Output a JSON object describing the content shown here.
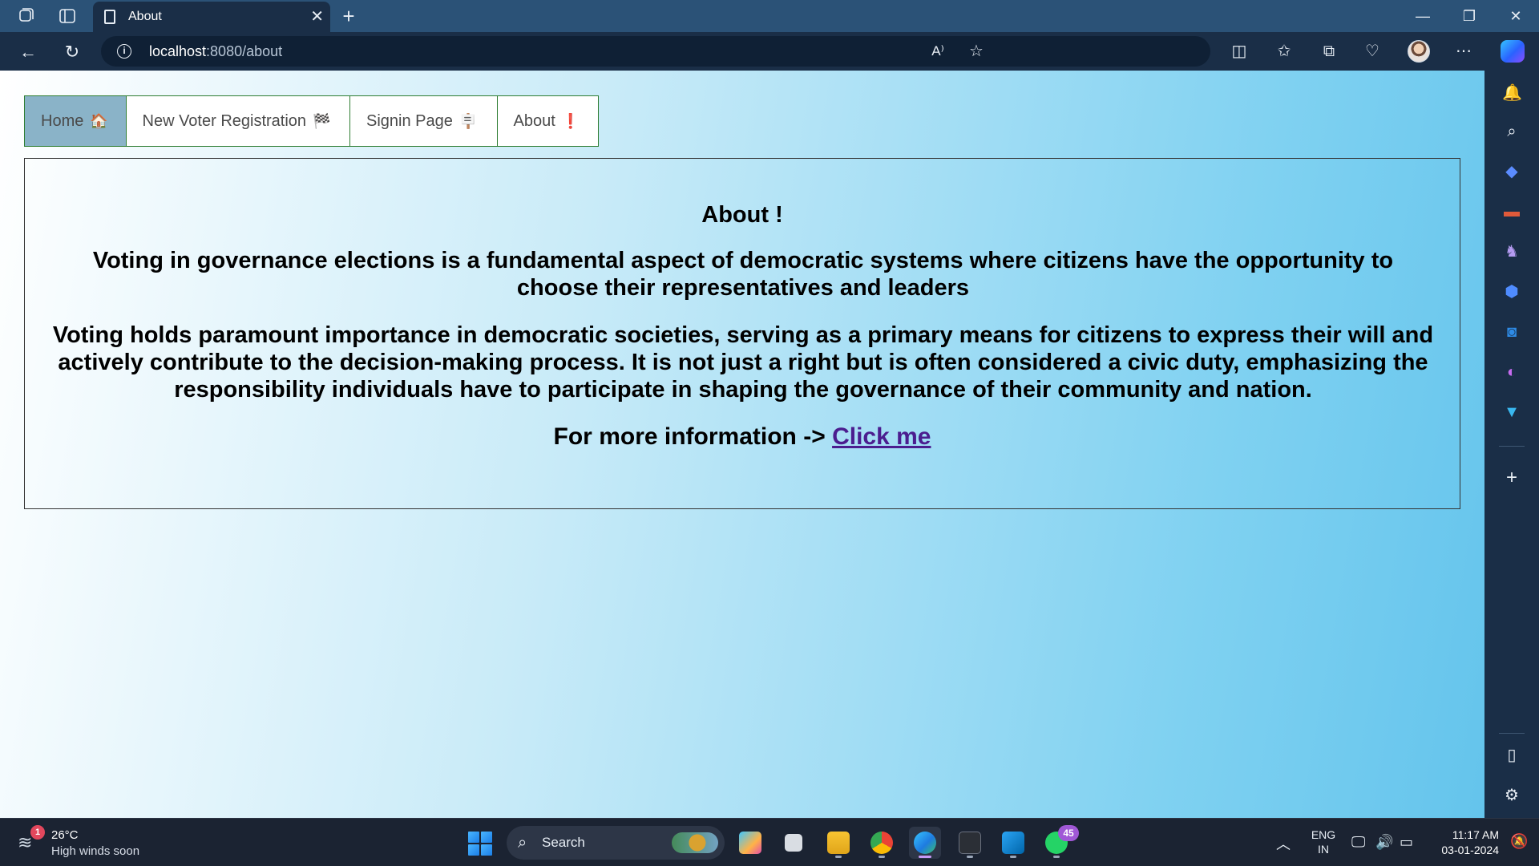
{
  "browser": {
    "tab_title": "About",
    "new_tab_glyph": "+",
    "url_host": "localhost",
    "url_path": ":8080/about",
    "icons": [
      "workspaces-icon",
      "tab-actions-icon",
      "back-icon",
      "refresh-icon",
      "read-aloud-icon",
      "favorite-star-icon",
      "split-screen-icon",
      "favorites-icon",
      "collections-icon",
      "browser-essentials-icon",
      "profile-avatar",
      "more-options-icon",
      "copilot-icon"
    ],
    "window_controls": [
      "minimize",
      "restore",
      "close"
    ]
  },
  "page": {
    "nav": {
      "home": "Home",
      "home_emoji": "🏠",
      "register": "New Voter Registration",
      "register_emoji": "🏁",
      "signin": "Signin Page",
      "signin_emoji": "🪧",
      "about": "About",
      "about_emoji": "❗"
    },
    "about": {
      "title": "About !",
      "paragraph1": "Voting in governance elections is a fundamental aspect of democratic systems where citizens have the opportunity to choose their representatives and leaders",
      "paragraph2": "Voting holds paramount importance in democratic societies, serving as a primary means for citizens to express their will and actively contribute to the decision-making process. It is not just a right but is often considered a civic duty, emphasizing the responsibility individuals have to participate in shaping the governance of their community and nation.",
      "more_prefix": "For more information -> ",
      "more_link": "Click me"
    },
    "colors": {
      "nav_border": "#2e7d32",
      "nav_active_bg": "#8ab3c8",
      "link": "#4b1d8f",
      "bg_gradient_end": "#64c4ec"
    }
  },
  "sidebar": {
    "icons": [
      "notifications-icon",
      "search-icon",
      "shopping-icon",
      "tools-icon",
      "games-icon",
      "copilot-side-icon",
      "outlook-icon",
      "designer-icon",
      "drop-icon",
      "add-icon",
      "hide-sidebar-icon",
      "settings-icon"
    ]
  },
  "taskbar": {
    "weather_temp": "26°C",
    "weather_desc": "High winds soon",
    "weather_badge": "1",
    "search_label": "Search",
    "whatsapp_badge": "45",
    "lang_line1": "ENG",
    "lang_line2": "IN",
    "time": "11:17 AM",
    "date": "03-01-2024"
  }
}
